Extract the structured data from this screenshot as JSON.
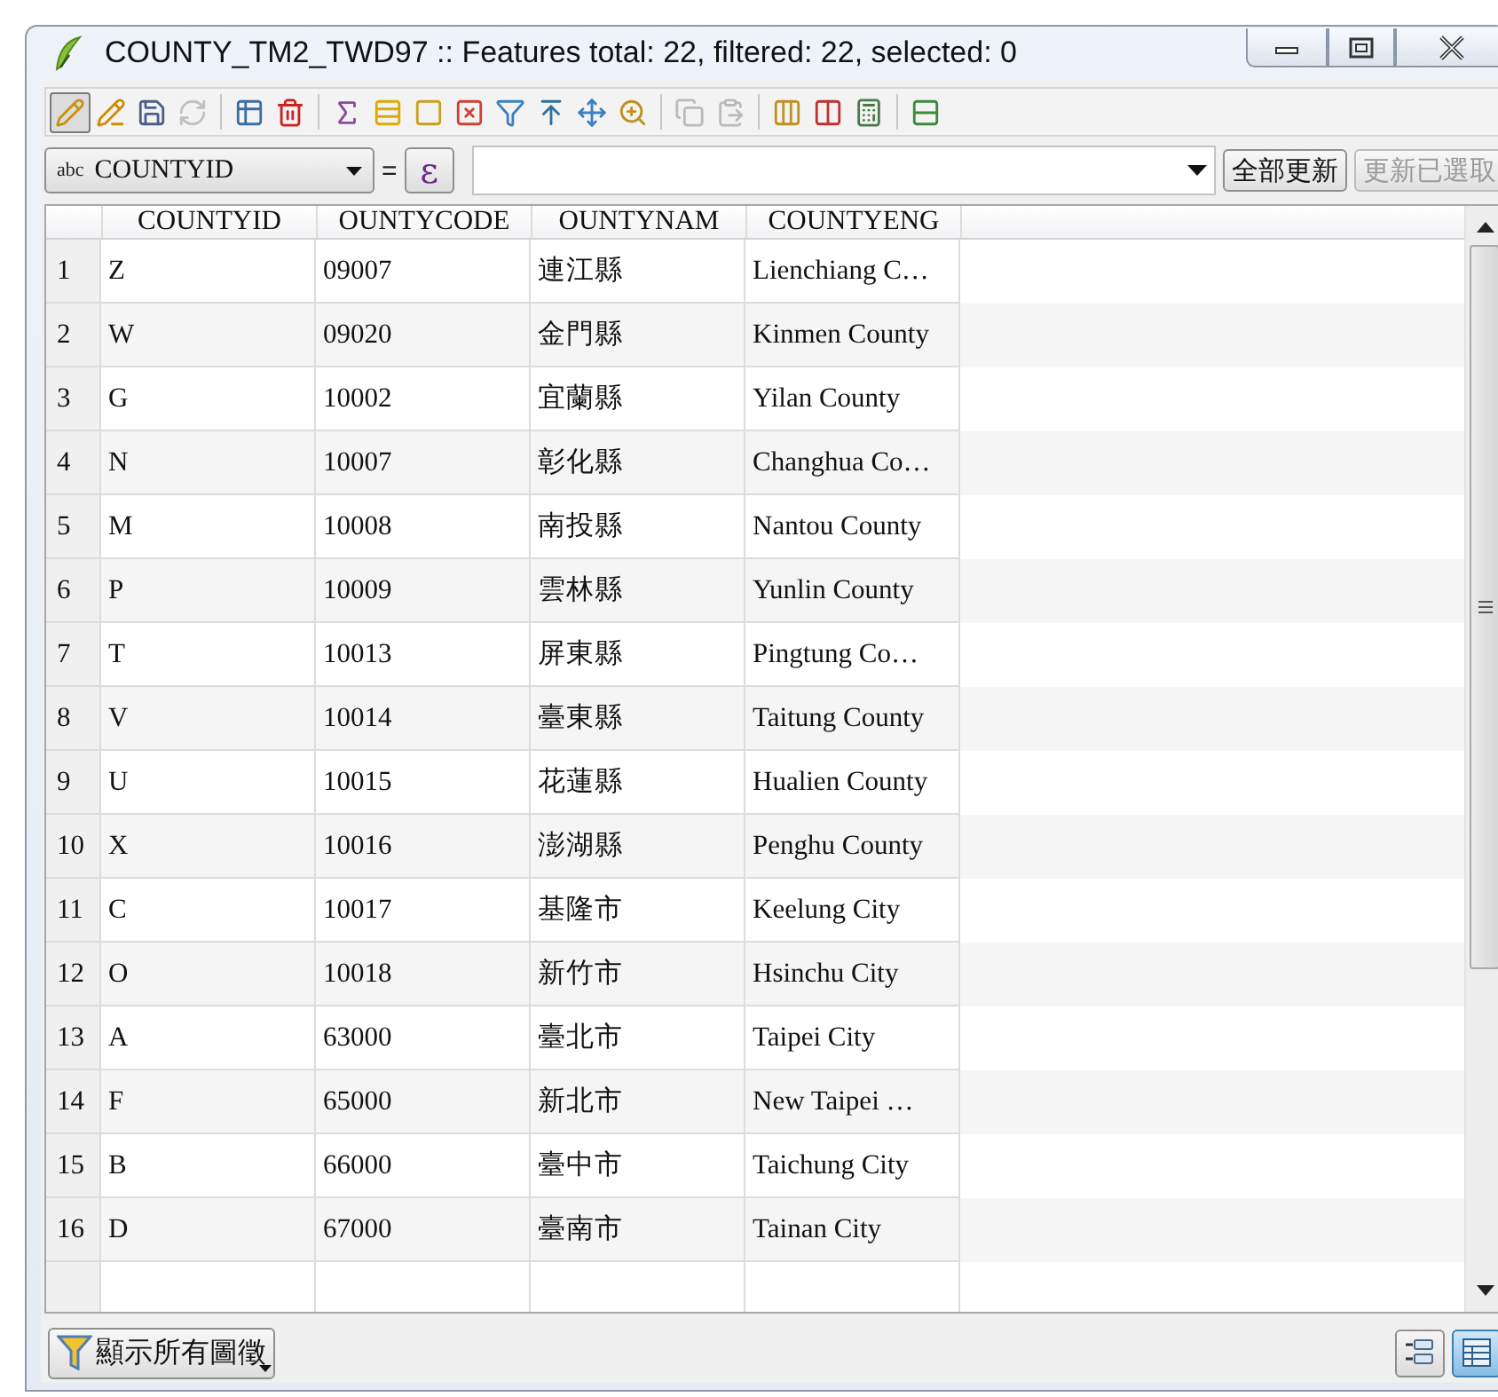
{
  "window": {
    "title": "COUNTY_TM2_TWD97 :: Features total: 22, filtered: 22, selected: 0"
  },
  "toolbar": [
    [
      {
        "on": true,
        "disabled": false
      },
      {
        "on": false,
        "disabled": false
      },
      {
        "on": false,
        "disabled": false
      },
      {
        "on": false,
        "disabled": true
      }
    ],
    [
      {
        "on": false,
        "disabled": false
      },
      {
        "on": false,
        "disabled": false
      }
    ],
    [
      {
        "on": false,
        "disabled": false
      },
      {
        "on": false,
        "disabled": false
      },
      {
        "on": false,
        "disabled": false
      },
      {
        "on": false,
        "disabled": false
      },
      {
        "on": false,
        "disabled": false
      },
      {
        "on": false,
        "disabled": false
      },
      {
        "on": false,
        "disabled": false
      },
      {
        "on": false,
        "disabled": false
      }
    ],
    [
      {
        "on": false,
        "disabled": true
      },
      {
        "on": false,
        "disabled": true
      }
    ],
    [
      {
        "on": false,
        "disabled": false
      },
      {
        "on": false,
        "disabled": false
      },
      {
        "on": false,
        "disabled": false
      }
    ],
    [
      {
        "on": false,
        "disabled": false
      }
    ]
  ],
  "filter_bar": {
    "field_type": "abc",
    "field": "COUNTYID",
    "operator": "=",
    "expression_button": "ε",
    "update_all": {
      "label": "全部更新",
      "disabled": false
    },
    "update_selected": {
      "label": "更新已選取",
      "disabled": true
    }
  },
  "table": {
    "columns": [
      "COUNTYID",
      "OUNTYCODE",
      "OUNTYNAM",
      "COUNTYENG"
    ],
    "rows": [
      {
        "number": "1",
        "cells": [
          "Z",
          "09007",
          "連江縣",
          "Lienchiang C…"
        ]
      },
      {
        "number": "2",
        "cells": [
          "W",
          "09020",
          "金門縣",
          "Kinmen County"
        ]
      },
      {
        "number": "3",
        "cells": [
          "G",
          "10002",
          "宜蘭縣",
          "Yilan County"
        ]
      },
      {
        "number": "4",
        "cells": [
          "N",
          "10007",
          "彰化縣",
          "Changhua Co…"
        ]
      },
      {
        "number": "5",
        "cells": [
          "M",
          "10008",
          "南投縣",
          "Nantou County"
        ]
      },
      {
        "number": "6",
        "cells": [
          "P",
          "10009",
          "雲林縣",
          "Yunlin County"
        ]
      },
      {
        "number": "7",
        "cells": [
          "T",
          "10013",
          "屏東縣",
          "Pingtung Co…"
        ]
      },
      {
        "number": "8",
        "cells": [
          "V",
          "10014",
          "臺東縣",
          "Taitung County"
        ]
      },
      {
        "number": "9",
        "cells": [
          "U",
          "10015",
          "花蓮縣",
          "Hualien County"
        ]
      },
      {
        "number": "10",
        "cells": [
          "X",
          "10016",
          "澎湖縣",
          "Penghu County"
        ]
      },
      {
        "number": "11",
        "cells": [
          "C",
          "10017",
          "基隆市",
          "Keelung City"
        ]
      },
      {
        "number": "12",
        "cells": [
          "O",
          "10018",
          "新竹市",
          "Hsinchu City"
        ]
      },
      {
        "number": "13",
        "cells": [
          "A",
          "63000",
          "臺北市",
          "Taipei City"
        ]
      },
      {
        "number": "14",
        "cells": [
          "F",
          "65000",
          "新北市",
          "New Taipei …"
        ]
      },
      {
        "number": "15",
        "cells": [
          "B",
          "66000",
          "臺中市",
          "Taichung City"
        ]
      },
      {
        "number": "16",
        "cells": [
          "D",
          "67000",
          "臺南市",
          "Tainan City"
        ]
      }
    ]
  },
  "bottom_bar": {
    "filter_button": "顯示所有圖徵",
    "views": [
      {
        "kind": "form",
        "selected": false
      },
      {
        "kind": "table",
        "selected": true
      }
    ]
  }
}
